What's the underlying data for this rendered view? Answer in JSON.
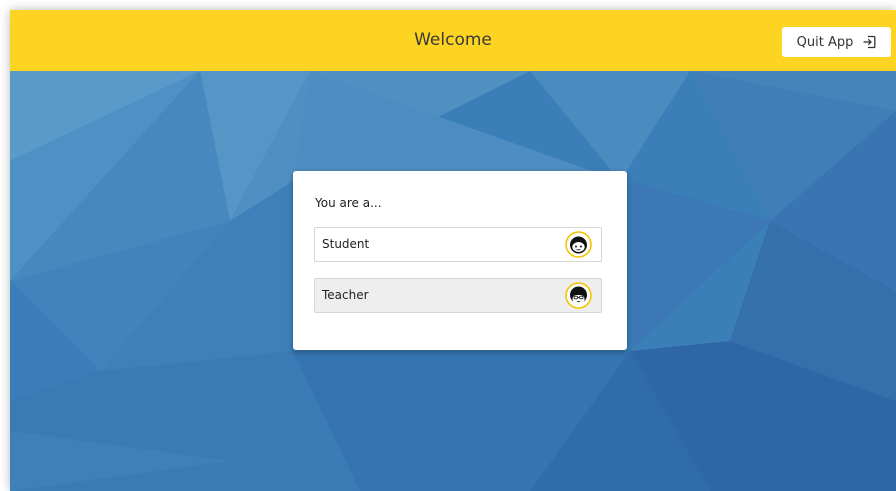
{
  "header": {
    "title": "Welcome",
    "quit_label": "Quit App",
    "quit_icon": "exit-icon",
    "bar_color": "#fdd421"
  },
  "background": {
    "style": "low-poly-blue",
    "base_color": "#3b7fb8"
  },
  "card": {
    "prompt": "You are a...",
    "options": [
      {
        "label": "Student",
        "icon": "student-face-icon",
        "selected": false
      },
      {
        "label": "Teacher",
        "icon": "teacher-face-icon",
        "selected": true
      }
    ]
  },
  "colors": {
    "accent": "#fdd421",
    "avatar_ring": "#f5c400"
  }
}
